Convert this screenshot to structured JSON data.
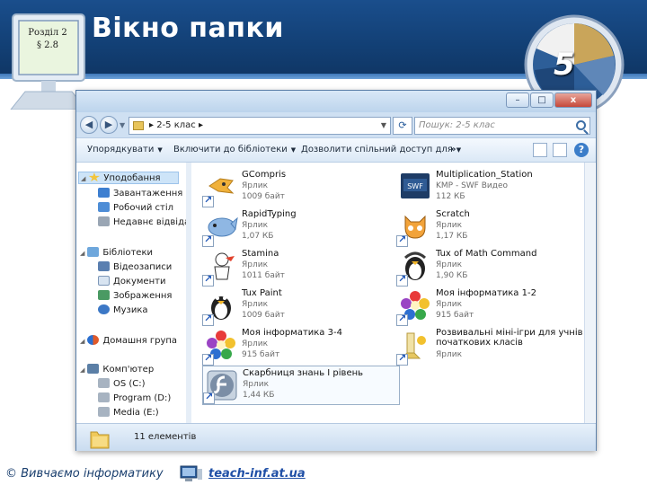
{
  "slide": {
    "section": "Розділ 2",
    "paragraph": "§ 2.8",
    "title": "Вікно папки",
    "badge_number": "5"
  },
  "window": {
    "address": "▸ 2-5 клас ▸",
    "search_placeholder": "Пошук: 2-5 клас",
    "controls": [
      "–",
      "□",
      "x"
    ],
    "toolbar": {
      "organize": "Упорядкувати",
      "include": "Включити до бібліотеки",
      "share": "Дозволити спільний доступ для",
      "more": "»"
    },
    "nav": {
      "favorites": "Уподобання",
      "favorites_items": [
        "Завантаження",
        "Робочий стіл",
        "Недавнє відвідан"
      ],
      "libraries": "Бібліотеки",
      "libraries_items": [
        "Відеозаписи",
        "Документи",
        "Зображення",
        "Музика"
      ],
      "homegroup": "Домашня група",
      "computer": "Комп'ютер",
      "computer_items": [
        "OS (C:)",
        "Program (D:)",
        "Media (E:)"
      ]
    },
    "files": [
      {
        "name": "GCompris",
        "type": "Ярлик",
        "size": "1009 байт",
        "icon": "gcompris-icon"
      },
      {
        "name": "Multiplication_Station",
        "type": "KMP - SWF Видео",
        "size": "112 КБ",
        "icon": "swf-icon"
      },
      {
        "name": "RapidTyping",
        "type": "Ярлик",
        "size": "1,07 КБ",
        "icon": "rapidtyping-icon"
      },
      {
        "name": "Scratch",
        "type": "Ярлик",
        "size": "1,17 КБ",
        "icon": "scratch-icon"
      },
      {
        "name": "Stamina",
        "type": "Ярлик",
        "size": "1011 байт",
        "icon": "stamina-icon"
      },
      {
        "name": "Tux of Math Command",
        "type": "Ярлик",
        "size": "1,90 КБ",
        "icon": "tux-math-icon"
      },
      {
        "name": "Tux Paint",
        "type": "Ярлик",
        "size": "1009 байт",
        "icon": "tux-paint-icon"
      },
      {
        "name": "Моя інформатика 1-2",
        "type": "Ярлик",
        "size": "915 байт",
        "icon": "flower-icon"
      },
      {
        "name": "Моя інформатика 3-4",
        "type": "Ярлик",
        "size": "915 байт",
        "icon": "flower-icon"
      },
      {
        "name": "Розвивальні міні-ігри для учнів початкових класів",
        "type": "Ярлик",
        "size": "",
        "icon": "minigames-icon"
      },
      {
        "name": "Скарбниця знань I рівень",
        "type": "Ярлик",
        "size": "1,44 КБ",
        "icon": "flash-icon"
      }
    ],
    "status": "11 елементів"
  },
  "footer": {
    "copyright": "© Вивчаємо інформатику",
    "link": "teach-inf.at.ua"
  }
}
